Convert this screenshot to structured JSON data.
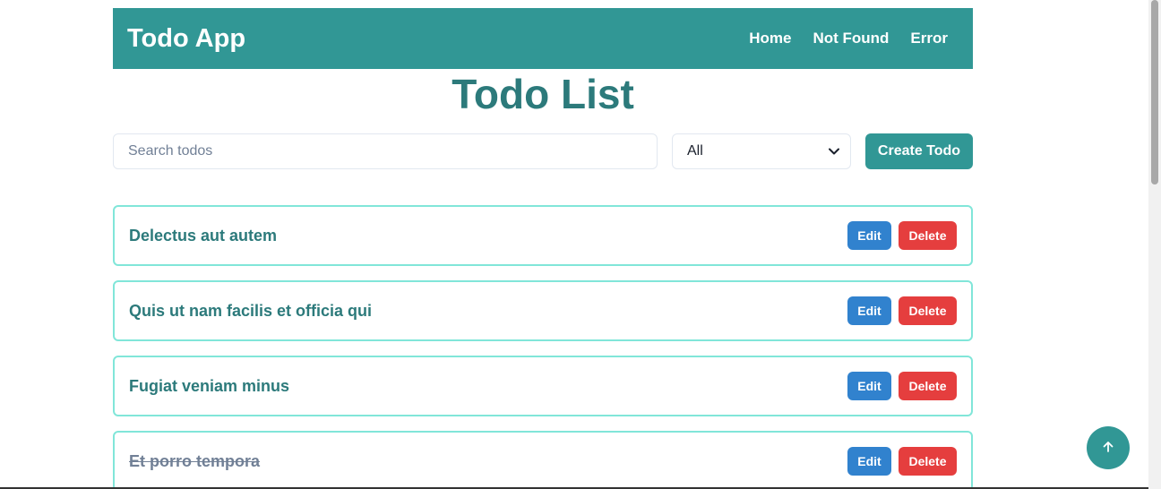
{
  "navbar": {
    "brand": "Todo App",
    "links": [
      "Home",
      "Not Found",
      "Error"
    ]
  },
  "main": {
    "title": "Todo List",
    "search": {
      "placeholder": "Search todos",
      "value": ""
    },
    "filter": {
      "selected": "All"
    },
    "create_label": "Create Todo"
  },
  "todos": [
    {
      "title": "Delectus aut autem",
      "completed": false,
      "edit_label": "Edit",
      "delete_label": "Delete"
    },
    {
      "title": "Quis ut nam facilis et officia qui",
      "completed": false,
      "edit_label": "Edit",
      "delete_label": "Delete"
    },
    {
      "title": "Fugiat veniam minus",
      "completed": false,
      "edit_label": "Edit",
      "delete_label": "Delete"
    },
    {
      "title": "Et porro tempora",
      "completed": true,
      "edit_label": "Edit",
      "delete_label": "Delete"
    }
  ],
  "icons": {
    "filter_chevron": "chevron-down-icon",
    "scroll_top": "arrow-up-icon"
  },
  "colors": {
    "primary": "#319795",
    "title": "#2c7a7b",
    "border": "#81e6d9",
    "edit": "#3182ce",
    "delete": "#e53e3e"
  }
}
